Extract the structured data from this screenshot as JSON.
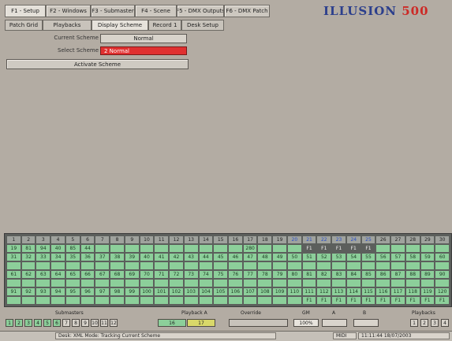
{
  "tabs": [
    "F1 - Setup",
    "F2 - Windows",
    "F3 - Submaster",
    "F4 - Scene",
    "F5 - DMX Outputs",
    "F6 - DMX Patch"
  ],
  "brand": {
    "name": "ILLUSION",
    "number": "500"
  },
  "subtabs": [
    "Patch Grid",
    "Playbacks",
    "Display Scheme",
    "Record 1",
    "Desk Setup"
  ],
  "scheme": {
    "current_label": "Current Scheme",
    "current_value": "Normal",
    "select_label": "Select Scheme",
    "select_value": "2 Normal",
    "activate_label": "Activate Scheme"
  },
  "grid": {
    "header": [
      "1",
      "2",
      "3",
      "4",
      "5",
      "6",
      "7",
      "8",
      "9",
      "10",
      "11",
      "12",
      "13",
      "14",
      "15",
      "16",
      "17",
      "18",
      "19",
      "20",
      "21",
      "22",
      "23",
      "24",
      "25",
      "26",
      "27",
      "28",
      "29",
      "30"
    ],
    "rows": [
      [
        "19",
        "81",
        "94",
        "40",
        "85",
        "44",
        "",
        "",
        "",
        "",
        "",
        "",
        "",
        "",
        "",
        "",
        "280",
        "",
        "",
        "",
        "F1",
        "F1",
        "F1",
        "F1",
        "F1",
        "",
        "",
        "",
        "",
        ""
      ],
      [
        "31",
        "32",
        "33",
        "34",
        "35",
        "36",
        "37",
        "38",
        "39",
        "40",
        "41",
        "42",
        "43",
        "44",
        "45",
        "46",
        "47",
        "48",
        "49",
        "50",
        "51",
        "52",
        "53",
        "54",
        "55",
        "56",
        "57",
        "58",
        "59",
        "60"
      ],
      [
        "",
        "",
        "",
        "",
        "",
        "",
        "",
        "",
        "",
        "",
        "",
        "",
        "",
        "",
        "",
        "",
        "",
        "",
        "",
        "",
        "",
        "",
        "",
        "",
        "",
        "",
        "",
        "",
        "",
        ""
      ],
      [
        "61",
        "62",
        "63",
        "64",
        "65",
        "66",
        "67",
        "68",
        "69",
        "70",
        "71",
        "72",
        "73",
        "74",
        "75",
        "76",
        "77",
        "78",
        "79",
        "80",
        "81",
        "82",
        "83",
        "84",
        "85",
        "86",
        "87",
        "88",
        "89",
        "90"
      ],
      [
        "",
        "",
        "",
        "",
        "",
        "",
        "",
        "",
        "",
        "",
        "",
        "",
        "",
        "",
        "",
        "",
        "",
        "",
        "",
        "",
        "",
        "",
        "",
        "",
        "",
        "",
        "",
        "",
        "",
        ""
      ],
      [
        "91",
        "92",
        "93",
        "94",
        "95",
        "96",
        "97",
        "98",
        "99",
        "100",
        "101",
        "102",
        "103",
        "104",
        "105",
        "106",
        "107",
        "108",
        "109",
        "110",
        "111",
        "112",
        "113",
        "114",
        "115",
        "116",
        "117",
        "118",
        "119",
        "120"
      ],
      [
        "",
        "",
        "",
        "",
        "",
        "",
        "",
        "",
        "",
        "",
        "",
        "",
        "",
        "",
        "",
        "",
        "",
        "",
        "",
        "",
        "F1",
        "F1",
        "F1",
        "F1",
        "F1",
        "F1",
        "F1",
        "F1",
        "F1",
        "F1"
      ]
    ]
  },
  "labels": {
    "submasters": "Submasters",
    "playback": "Playback A",
    "override": "Override",
    "grandmaster": "GM",
    "a": "A",
    "b": "B",
    "playbacks": "Playbacks"
  },
  "submaster_buttons": [
    "1",
    "2",
    "3",
    "4",
    "5",
    "6",
    "7",
    "8",
    "9",
    "10",
    "11",
    "12"
  ],
  "playback_values": {
    "a": "16",
    "b": "17"
  },
  "gm_value": "100%",
  "playback_buttons": [
    "1",
    "2",
    "3",
    "4"
  ],
  "statusbar": {
    "left": "Desk: XML  Mode: Tracking  Current Scheme",
    "right_a": "MIDI",
    "right_b": "11:11:44  18/07/2003"
  }
}
